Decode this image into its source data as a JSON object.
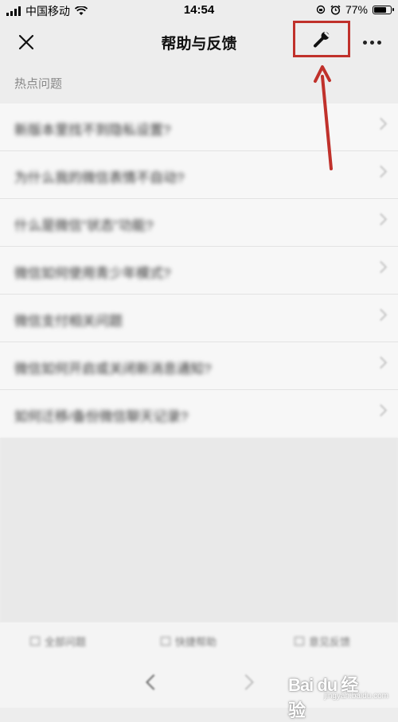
{
  "status_bar": {
    "carrier": "中国移动",
    "time": "14:54",
    "battery": "77%",
    "battery_level": 0.77
  },
  "header": {
    "title": "帮助与反馈"
  },
  "section": {
    "title": "热点问题"
  },
  "questions": [
    "新版本里找不到隐私设置?",
    "为什么我的微信表情不自动?",
    "什么是微信\"状态\"功能?",
    "微信如何使用青少年模式?",
    "微信支付相关问题",
    "微信如何开启或关闭新消息通知?",
    "如何迁移/备份微信聊天记录?"
  ],
  "bottom_tabs": [
    "全部问题",
    "快捷帮助",
    "意见反馈"
  ],
  "watermark": {
    "logo": "Bai du 经验",
    "sub": "jingyan.baidu.com"
  },
  "colors": {
    "annotation": "#c0312b",
    "background": "#ededed"
  },
  "icons": {
    "close": "close-icon",
    "tool": "wrench-icon",
    "more": "more-icon"
  }
}
